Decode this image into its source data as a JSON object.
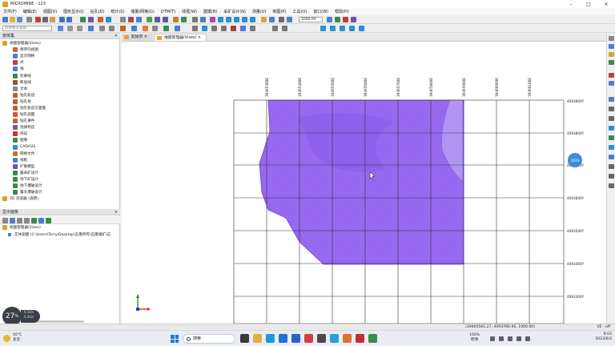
{
  "window": {
    "title": "MICROMINE - 123"
  },
  "menu": [
    "文件(F)",
    "编辑(E)",
    "视图(V)",
    "图形显示(I)",
    "钻孔(D)",
    "统计(S)",
    "储量/网格(G)",
    "DTM(T)",
    "线框(W)",
    "建模(B)",
    "采矿设计(N)",
    "测量(U)",
    "制图(P)",
    "工具(O)",
    "窗口(W)",
    "帮助(H)"
  ],
  "toolbar": {
    "scale_value": "1000.00",
    "filter_placeholder": "选择要过滤器"
  },
  "vizex_panel": {
    "title": "窗体集",
    "root_label": "视图管理器(Vizex)",
    "items": [
      "保存的视图",
      "显示网格",
      "点",
      "线",
      "轮廓线",
      "断层线",
      "文本",
      "钻孔轨迹",
      "钻孔柱",
      "钻孔轨迹方面图",
      "钻孔剖面",
      "钻孔事件",
      "地质构造",
      "块段",
      "图像",
      "CAD/GIS",
      "网格文件",
      "线框",
      "扩散模型",
      "露采矿设计",
      "地下矿设计",
      "地下爆破设计",
      "露天爆破设计"
    ],
    "root2_label": "3D 流道器 (透明)"
  },
  "display_panel": {
    "title": "显示面板",
    "root_label": "视图管理器(Vizex)",
    "item_label": "实体剖面 (C:\\Users\\Terry\\Desktop\\石墨所有\\石墨储矿\\石"
  },
  "tabs": [
    {
      "label": "起始页",
      "active": false
    },
    {
      "label": "堆图管理器(Vizex)",
      "active": true
    }
  ],
  "view": {
    "easting_labels": [
      "39465300E",
      "39465400E",
      "39465500E",
      "39465600E",
      "39465700E",
      "39465800E",
      "39465900E",
      "39466000E",
      "39466100E"
    ],
    "northing_labels": [
      "4093900Y",
      "4093800Y",
      "4093700Y",
      "4093600Y",
      "4093500Y",
      "4093400Y",
      "4093300Y",
      "4093200Y",
      "4093100Y"
    ],
    "badge_text": "100%",
    "colors": {
      "body_fill": "#9b6cf2",
      "body_edge": "#6e3ad6",
      "grid": "#333333"
    }
  },
  "zoom_widget": {
    "value": "27",
    "unit": "%",
    "up": "0.1k/s",
    "down": "0.2k/s"
  },
  "status": {
    "coords": "(39465561.27, 4093766.06, 1000.00)",
    "mode": "VE - off"
  },
  "taskbar": {
    "weather_temp": "16°C",
    "weather_text": "多云",
    "search_placeholder": "搜索",
    "volume_pct": "100%",
    "volume_label": "明清",
    "time": "9:03",
    "date": "2023/6/3"
  }
}
